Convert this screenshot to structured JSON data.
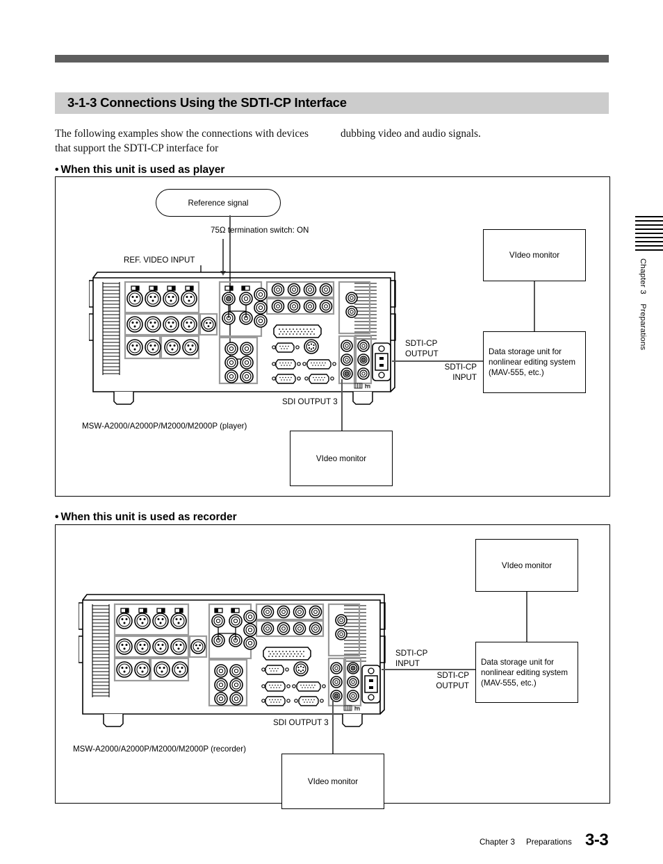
{
  "page": {
    "section_number": "3-1-3",
    "section_title": "3-1-3 Connections Using the SDTI-CP Interface",
    "intro_col1": "The following examples show the connections with devices that support the SDTI-CP interface for",
    "intro_col2": "dubbing video and audio signals.",
    "footer_chapter": "Chapter 3",
    "footer_section": "Preparations",
    "footer_page": "3-3",
    "side_tab": "Chapter 3    Preparations",
    "side_tab_rule_count": 9,
    "colors": {
      "top_rule": "#5e5e5e",
      "title_band": "#cccccc",
      "wire": "#555555",
      "ink": "#000000"
    }
  },
  "player": {
    "heading": "When this unit is used as player",
    "bullet": "•",
    "reference_signal": "Reference signal",
    "termination": "75Ω termination switch: ON",
    "ref_video_input": "REF. VIDEO INPUT",
    "unit_caption": "MSW-A2000/A2000P/M2000/M2000P (player)",
    "sdti_out_label": "SDTI-CP\nOUTPUT",
    "sdti_in_label": "SDTI-CP\nINPUT",
    "sdi_output_label": "SDI OUTPUT 3",
    "video_monitor_top": "VIdeo monitor",
    "video_monitor_bottom": "VIdeo monitor",
    "data_storage": "Data storage unit for\nnonlinear editing system\n(MAV-555, etc.)"
  },
  "recorder": {
    "heading": "When this unit is used as recorder",
    "bullet": "•",
    "unit_caption": "MSW-A2000/A2000P/M2000/M2000P (recorder)",
    "sdti_in_label": "SDTI-CP\nINPUT",
    "sdti_out_label": "SDTI-CP\nOUTPUT",
    "sdi_output_label": "SDI OUTPUT 3",
    "video_monitor_top": "VIdeo monitor",
    "video_monitor_bottom": "VIdeo monitor",
    "data_storage": "Data storage unit for\nnonlinear editing system\n(MAV-555, etc.)"
  }
}
